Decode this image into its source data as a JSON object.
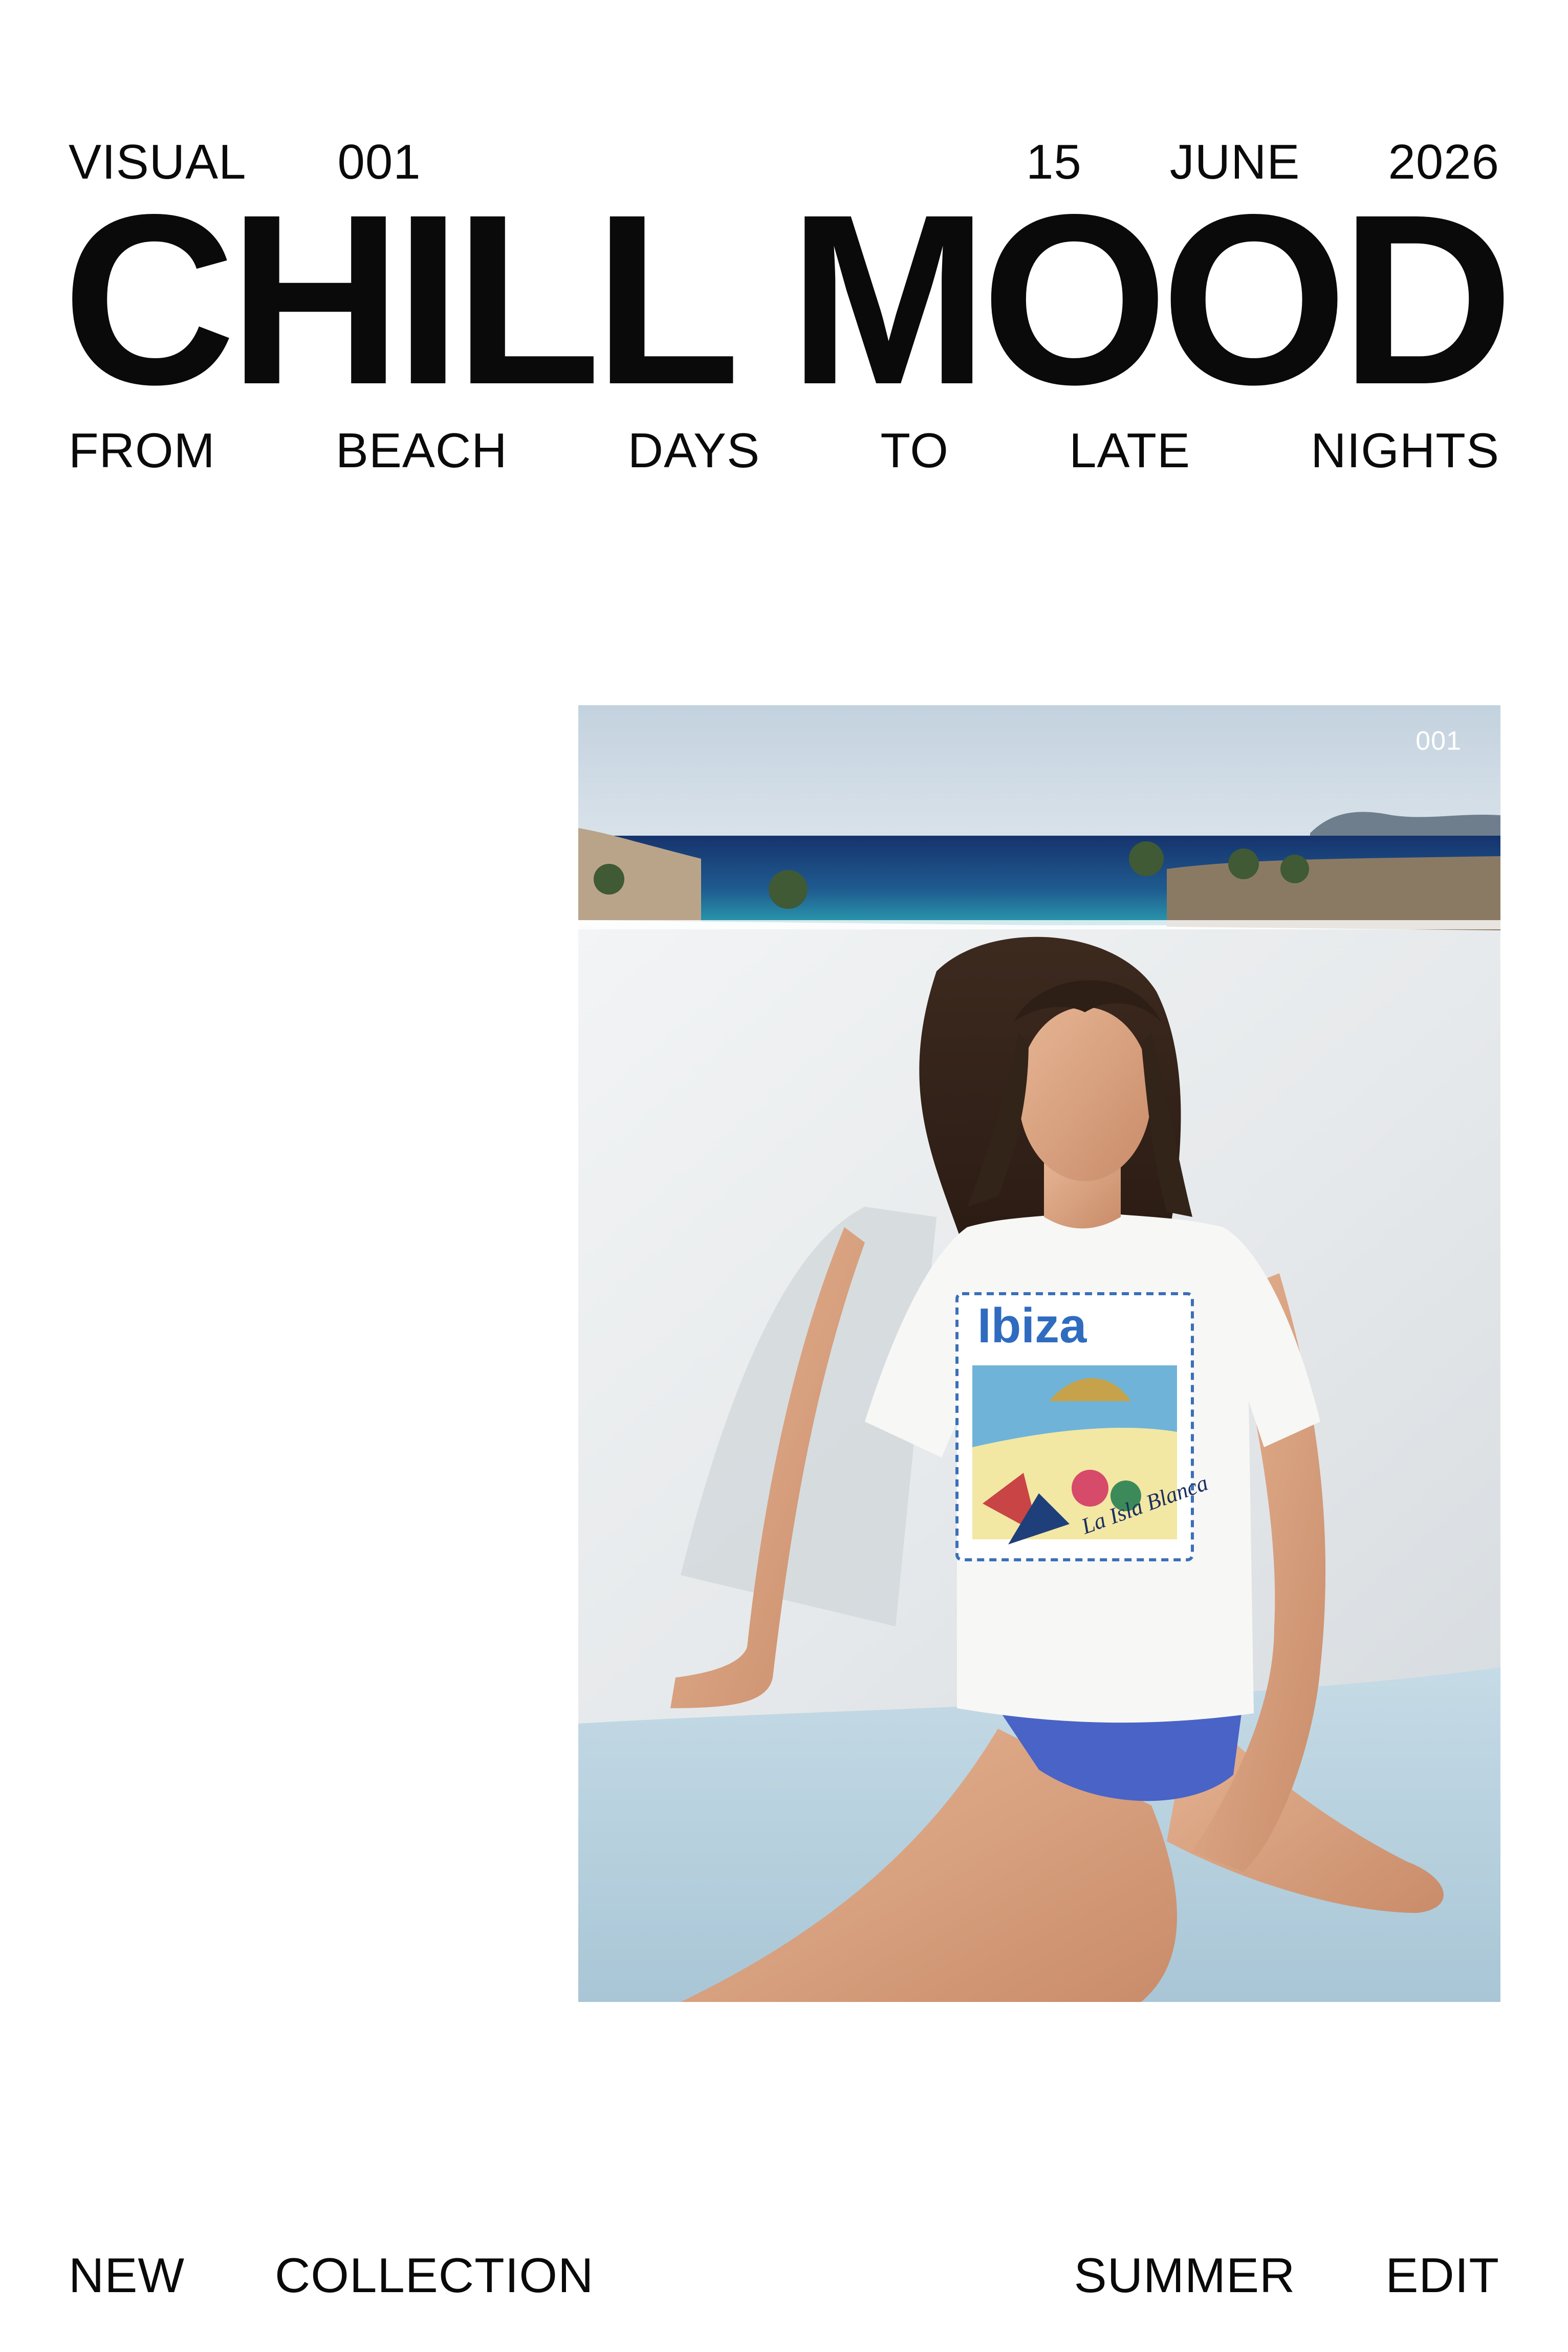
{
  "header": {
    "visual_label": "VISUAL",
    "visual_number": "001",
    "date_day": "15",
    "date_month": "JUNE",
    "date_year": "2026"
  },
  "headline": "CHILL MOOD",
  "tagline": [
    "FROM",
    "BEACH",
    "DAYS",
    "TO",
    "LATE",
    "NIGHTS"
  ],
  "photo": {
    "number": "001",
    "tshirt_print_title": "Ibiza",
    "tshirt_print_sub": "La Isla Blanca"
  },
  "footer": {
    "new_label": "NEW",
    "collection_label": "COLLECTION",
    "summer_label": "SUMMER",
    "edit_label": "EDIT"
  },
  "colors": {
    "text": "#0a0a0a",
    "background": "#ffffff",
    "sky": "#c9d6e2",
    "sea": "#1b3c78",
    "wall": "#e9ecee",
    "cushion": "#b9d2df",
    "bikini": "#4a63c6"
  }
}
